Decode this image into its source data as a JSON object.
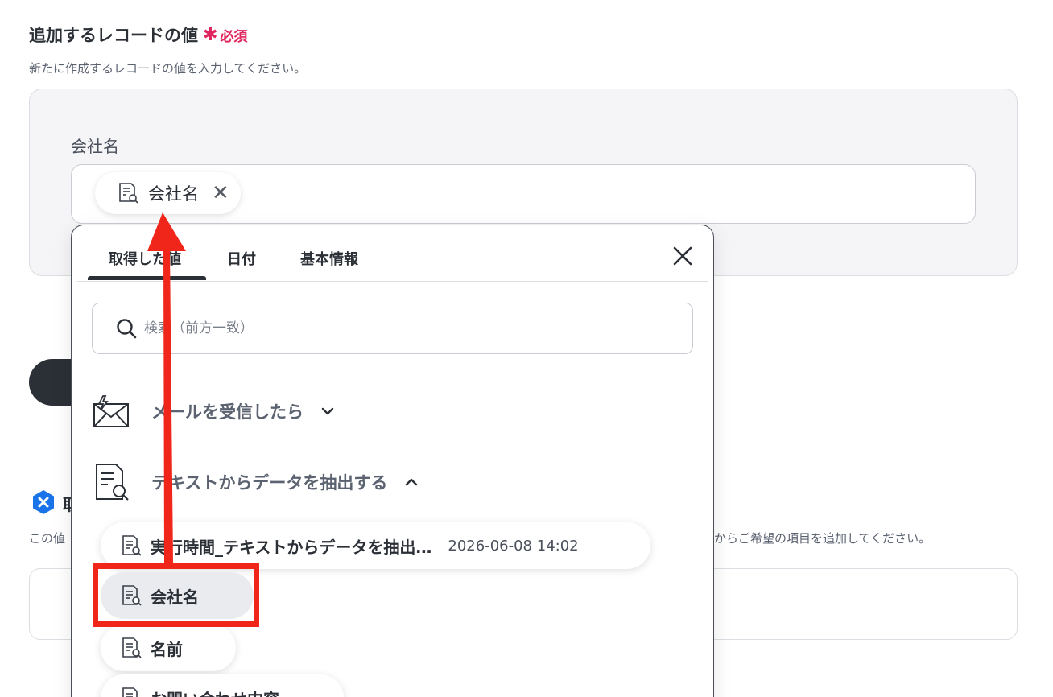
{
  "header": {
    "title": "追加するレコードの値",
    "required_mark": "✱",
    "required_text": "必須",
    "description": "新たに作成するレコードの値を入力してください。"
  },
  "field": {
    "label": "会社名",
    "chip_label": "会社名",
    "chip_close": "✕"
  },
  "lower_section": {
    "title": "取",
    "description_left": "この値",
    "description_right": "からご希望の項目を追加してください。"
  },
  "popup": {
    "tabs": [
      "取得した値",
      "日付",
      "基本情報"
    ],
    "active_tab": 0,
    "search_placeholder": "検索（前方一致）",
    "groups": [
      {
        "label": "メールを受信したら",
        "expanded": false
      },
      {
        "label": "テキストからデータを抽出する",
        "expanded": true
      }
    ],
    "items": [
      {
        "label": "実行時間_テキストからデータを抽出…",
        "date": "2026-06-08 14:02"
      },
      {
        "label": "会社名",
        "date": ""
      },
      {
        "label": "名前",
        "date": ""
      },
      {
        "label": "お問い合わせ内容",
        "date": ""
      }
    ]
  },
  "colors": {
    "required": "#e0245e",
    "annotation": "#f0261b",
    "dark": "#2b2f36",
    "badge": "#1a73e8"
  }
}
